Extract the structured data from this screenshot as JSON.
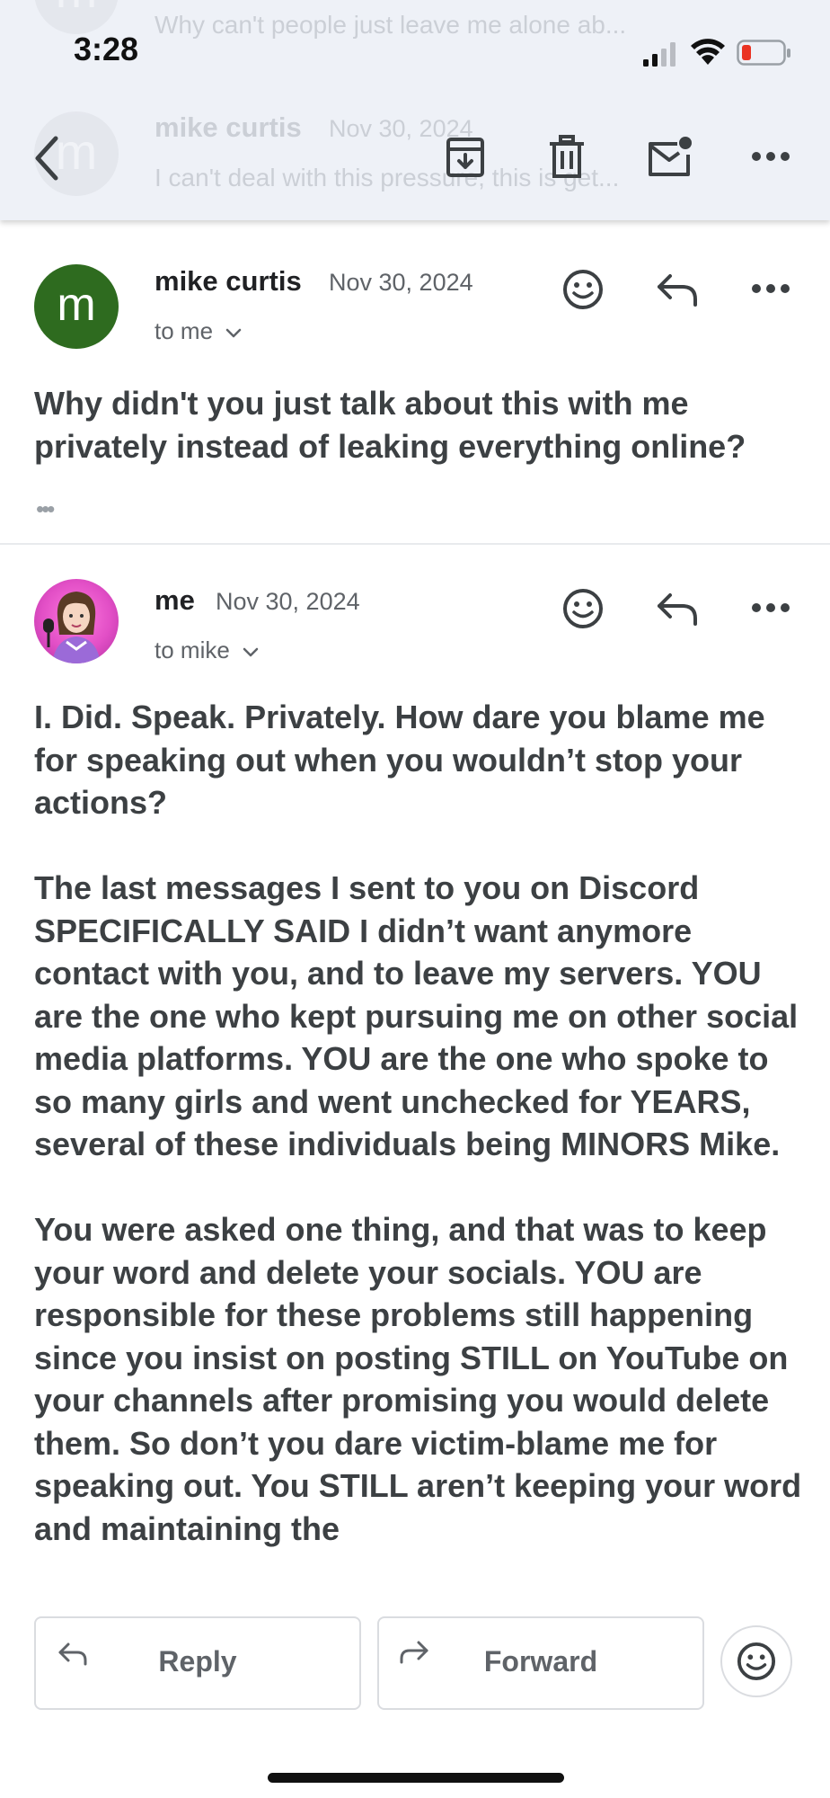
{
  "status_bar": {
    "time": "3:28"
  },
  "background_rows": [
    {
      "avatar_letter": "m",
      "preview": "Why can't people just leave me alone ab..."
    },
    {
      "avatar_letter": "m",
      "sender": "mike curtis",
      "date": "Nov 30, 2024",
      "preview": "I can't deal with this pressure, this is get..."
    }
  ],
  "toolbar": {
    "back_icon": "back-arrow-icon",
    "archive_icon": "archive-icon",
    "delete_icon": "trash-icon",
    "mark_unread_icon": "mark-unread-icon",
    "more_icon": "more-horizontal-icon"
  },
  "messages": [
    {
      "avatar_letter": "m",
      "avatar_color": "#2e6b1f",
      "sender": "mike curtis",
      "date": "Nov 30, 2024",
      "recipient": "to me",
      "body": "Why didn't you just talk about this with me privately instead of leaking everything online?",
      "trimmed_content": "•••"
    },
    {
      "sender": "me",
      "date": "Nov 30, 2024",
      "recipient": "to mike",
      "avatar_color": "#e24fc6",
      "body_paragraphs": [
        "I. Did. Speak. Privately. How dare you blame me for speaking out when you wouldn’t stop your actions?",
        "The last messages I sent to you on Discord SPECIFICALLY SAID I didn’t want anymore contact with you, and to leave my servers. YOU are the one who kept pursuing me on other social media platforms. YOU are the one who spoke to so many girls and went unchecked for YEARS, several of these individuals being MINORS Mike.",
        "You were asked one thing, and that was to keep your word and delete your socials. YOU are responsible for these problems still happening since you insist on posting STILL on YouTube on your channels after promising you would delete them. So don’t you dare victim-blame me for speaking out. You STILL aren’t keeping your word and maintaining the"
      ]
    }
  ],
  "bottom_actions": {
    "reply_label": "Reply",
    "forward_label": "Forward"
  },
  "colors": {
    "accent": "#1a73e8",
    "icon": "#5f6368",
    "text": "#3c4043"
  }
}
